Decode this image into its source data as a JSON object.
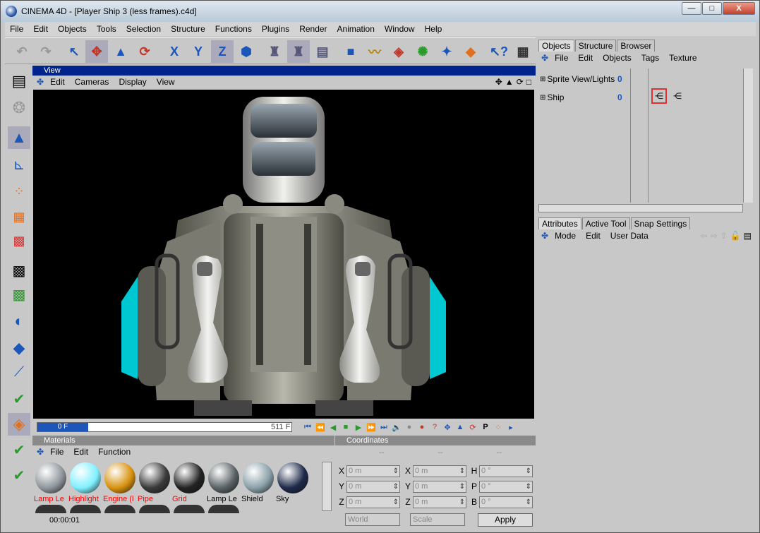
{
  "window": {
    "title": "CINEMA 4D - [Player Ship 3 (less frames).c4d]",
    "minimize": "—",
    "maximize": "□",
    "close": "X"
  },
  "menu": [
    "File",
    "Edit",
    "Objects",
    "Tools",
    "Selection",
    "Structure",
    "Functions",
    "Plugins",
    "Render",
    "Animation",
    "Window",
    "Help"
  ],
  "view": {
    "title": "View",
    "menu": [
      "Edit",
      "Cameras",
      "Display",
      "View"
    ]
  },
  "timeline": {
    "current": "0 F",
    "end": "511 F",
    "progress": 0.2
  },
  "materials": {
    "title": "Materials",
    "menu": [
      "File",
      "Edit",
      "Function"
    ],
    "items": [
      {
        "label": "Lamp Le",
        "color": "#8f969c",
        "highlight": true
      },
      {
        "label": "Highlight",
        "color": "#7ff0ff",
        "highlight": true
      },
      {
        "label": "Engine (l",
        "color": "#d8920e",
        "highlight": true
      },
      {
        "label": "Pipe",
        "color": "#3a3a3a",
        "highlight": true
      },
      {
        "label": "Grid",
        "color": "#222222",
        "highlight": true
      },
      {
        "label": "Lamp Le",
        "color": "#5a6266",
        "highlight": false
      },
      {
        "label": "Shield",
        "color": "#8aa0a8",
        "highlight": false
      },
      {
        "label": "Sky",
        "color": "#1e2a4a",
        "highlight": false
      }
    ],
    "timecode": "00:00:01"
  },
  "coordinates": {
    "title": "Coordinates",
    "rows": [
      {
        "a": "X",
        "av": "0 m",
        "b": "X",
        "bv": "0 m",
        "c": "H",
        "cv": "0 °"
      },
      {
        "a": "Y",
        "av": "0 m",
        "b": "Y",
        "bv": "0 m",
        "c": "P",
        "cv": "0 °"
      },
      {
        "a": "Z",
        "av": "0 m",
        "b": "Z",
        "bv": "0 m",
        "c": "B",
        "cv": "0 °"
      }
    ],
    "world": "World",
    "scale": "Scale",
    "apply": "Apply",
    "dashes": "--"
  },
  "objects": {
    "tabs": [
      "Objects",
      "Structure",
      "Browser"
    ],
    "menu": [
      "File",
      "Edit",
      "Objects",
      "Tags",
      "Texture"
    ],
    "items": [
      {
        "name": "Sprite View/Lights",
        "badge": "0"
      },
      {
        "name": "Ship",
        "badge": "0"
      }
    ]
  },
  "attributes": {
    "tabs": [
      "Attributes",
      "Active Tool",
      "Snap Settings"
    ],
    "menu": [
      "Mode",
      "Edit",
      "User Data"
    ]
  },
  "colors": {
    "accent": "#00248c",
    "highlight_label": "#ff0000",
    "engine": "#00c8d2"
  }
}
